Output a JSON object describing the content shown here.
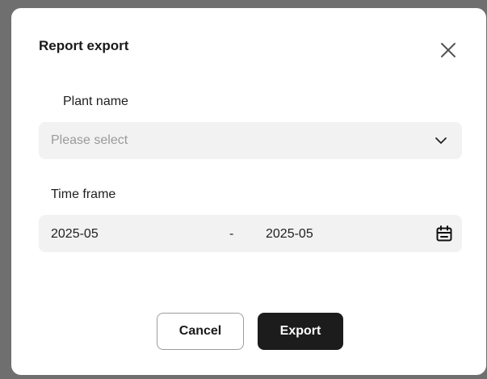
{
  "dialog": {
    "title": "Report export",
    "close_icon": "close-icon"
  },
  "plant": {
    "label": "Plant name",
    "placeholder": "Please select",
    "icon": "chevron-down-icon"
  },
  "time_frame": {
    "label": "Time frame",
    "start": "2025-05",
    "separator": "-",
    "end": "2025-05",
    "icon": "calendar-icon"
  },
  "actions": {
    "cancel_label": "Cancel",
    "export_label": "Export"
  },
  "colors": {
    "primary_button": "#1c1c1c",
    "field_background": "#f2f2f2",
    "placeholder_text": "#9a9a9a"
  }
}
